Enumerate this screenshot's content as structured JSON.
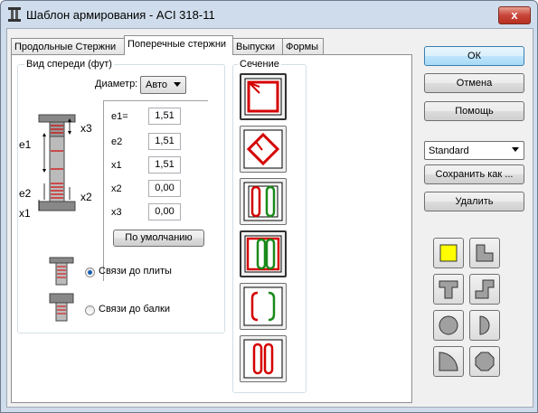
{
  "window": {
    "title": "Шаблон армирования - ACI 318-11",
    "close_label": "x"
  },
  "tabs": [
    {
      "label": "Продольные Стержни"
    },
    {
      "label": "Поперечные стержни"
    },
    {
      "label": "Выпуски"
    },
    {
      "label": "Формы"
    }
  ],
  "front_view": {
    "group_label": "Вид спереди (фут)",
    "diameter_label": "Диаметр:",
    "diameter_value": "Авто",
    "diagram_labels": {
      "e1": "e1",
      "e2": "e2",
      "x1": "x1",
      "x2": "x2",
      "x3": "x3"
    },
    "fields": [
      {
        "label": "e1=",
        "value": "1,51"
      },
      {
        "label": "e2",
        "value": "1,51"
      },
      {
        "label": "x1",
        "value": "1,51"
      },
      {
        "label": "x2",
        "value": "0,00"
      },
      {
        "label": "x3",
        "value": "0,00"
      }
    ],
    "default_button": "По умолчанию",
    "radio_slab": "Связи до плиты",
    "radio_beam": "Связи до балки",
    "selected_radio": "slab"
  },
  "section": {
    "group_label": "Сечение"
  },
  "actions": {
    "ok": "ОК",
    "cancel": "Отмена",
    "help": "Помощь",
    "preset_value": "Standard",
    "save_as": "Сохранить как ...",
    "delete": "Удалить"
  },
  "colors": {
    "selection_accent": "#ffff00",
    "rebar_red": "#d40000",
    "rebar_green": "#1a8a1a"
  }
}
